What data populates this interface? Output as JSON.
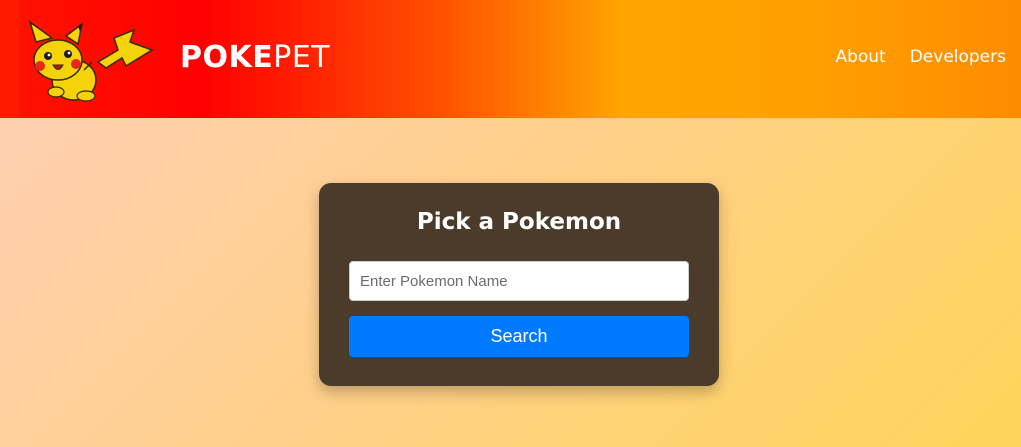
{
  "header": {
    "brand_bold": "POKE",
    "brand_light": "PET",
    "logo_icon": "pikachu-icon",
    "nav": [
      {
        "label": "About"
      },
      {
        "label": "Developers"
      }
    ],
    "colors": {
      "left": "#ff0000",
      "middle": "#ffa500",
      "right": "#ff8c00"
    }
  },
  "card": {
    "title": "Pick a Pokemon",
    "search_placeholder": "Enter Pokemon Name",
    "search_value": "",
    "button_label": "Search",
    "colors": {
      "background": "#4a3b2a",
      "button": "#007bff"
    }
  }
}
